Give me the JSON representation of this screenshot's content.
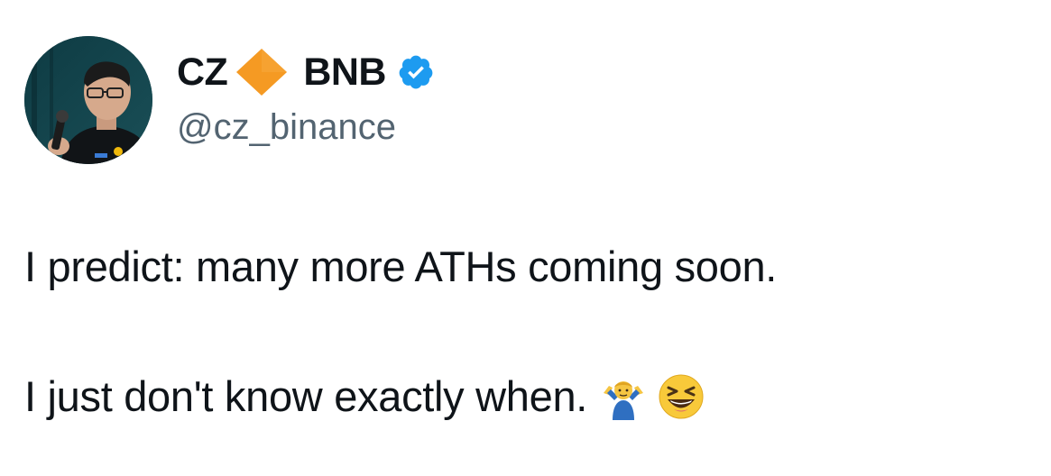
{
  "author": {
    "display_name_part1": "CZ",
    "display_name_part2": "BNB",
    "handle": "@cz_binance",
    "diamond_icon": "orange-diamond-icon",
    "verified_icon": "verified-badge-icon",
    "diamond_color": "#f59a23",
    "verified_color": "#1d9bf0"
  },
  "tweet": {
    "line1": "I predict: many more ATHs coming soon.",
    "line2": "I just don't know exactly when.",
    "emojis": [
      "person-shrugging-emoji",
      "grinning-squinting-face-emoji"
    ]
  }
}
